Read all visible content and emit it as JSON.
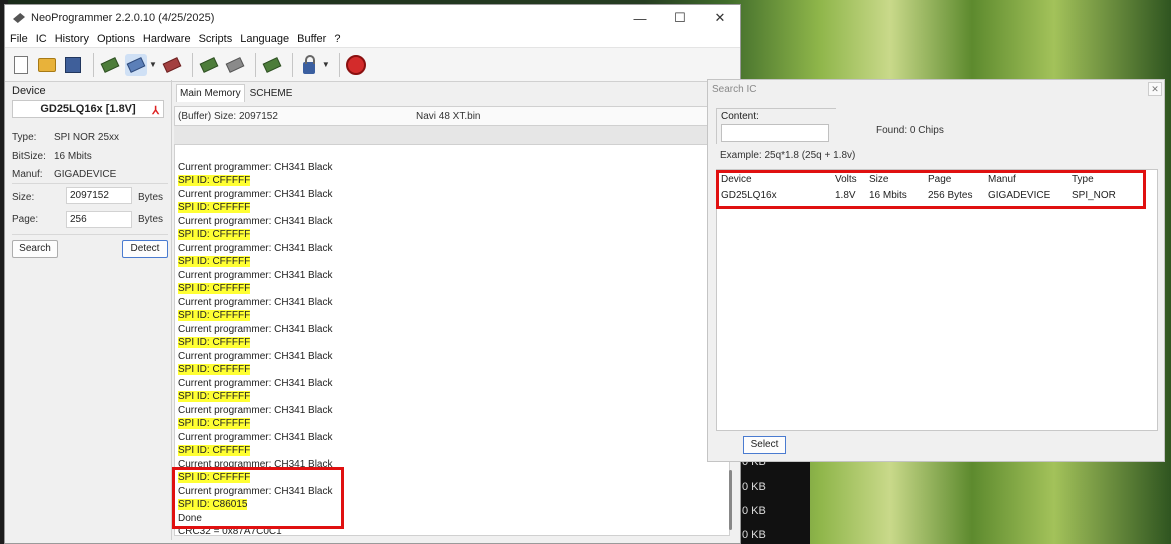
{
  "window": {
    "title": "NeoProgrammer 2.2.0.10 (4/25/2025)",
    "minimize": "—",
    "maximize": "☐",
    "close": "✕"
  },
  "menu": [
    "File",
    "IC",
    "History",
    "Options",
    "Hardware",
    "Scripts",
    "Language",
    "Buffer",
    "?"
  ],
  "device": {
    "section_label": "Device",
    "name": "GD25LQ16x [1.8V]",
    "type_key": "Type:",
    "type_val": "SPI NOR 25xx",
    "bitsize_key": "BitSize:",
    "bitsize_val": "16 Mbits",
    "manuf_key": "Manuf:",
    "manuf_val": "GIGADEVICE",
    "size_key": "Size:",
    "size_val": "2097152",
    "size_unit": "Bytes",
    "page_key": "Page:",
    "page_val": "256",
    "page_unit": "Bytes",
    "search_btn": "Search",
    "detect_btn": "Detect"
  },
  "tabs": [
    "Main Memory",
    "SCHEME"
  ],
  "buffer": {
    "size_text": "(Buffer) Size: 2097152",
    "file_name": "Navi 48 XT.bin"
  },
  "log": [
    {
      "text": "Current programmer: CH341 Black",
      "hl": false
    },
    {
      "text": "SPI ID: CFFFFF",
      "hl": true
    },
    {
      "text": "Current programmer: CH341 Black",
      "hl": false
    },
    {
      "text": "SPI ID: CFFFFF",
      "hl": true
    },
    {
      "text": "Current programmer: CH341 Black",
      "hl": false
    },
    {
      "text": "SPI ID: CFFFFF",
      "hl": true
    },
    {
      "text": "Current programmer: CH341 Black",
      "hl": false
    },
    {
      "text": "SPI ID: CFFFFF",
      "hl": true
    },
    {
      "text": "Current programmer: CH341 Black",
      "hl": false
    },
    {
      "text": "SPI ID: CFFFFF",
      "hl": true
    },
    {
      "text": "Current programmer: CH341 Black",
      "hl": false
    },
    {
      "text": "SPI ID: CFFFFF",
      "hl": true
    },
    {
      "text": "Current programmer: CH341 Black",
      "hl": false
    },
    {
      "text": "SPI ID: CFFFFF",
      "hl": true
    },
    {
      "text": "Current programmer: CH341 Black",
      "hl": false
    },
    {
      "text": "SPI ID: CFFFFF",
      "hl": true
    },
    {
      "text": "Current programmer: CH341 Black",
      "hl": false
    },
    {
      "text": "SPI ID: CFFFFF",
      "hl": true
    },
    {
      "text": "Current programmer: CH341 Black",
      "hl": false
    },
    {
      "text": "SPI ID: CFFFFF",
      "hl": true
    },
    {
      "text": "Current programmer: CH341 Black",
      "hl": false
    },
    {
      "text": "SPI ID: CFFFFF",
      "hl": true
    },
    {
      "text": "Current programmer: CH341 Black",
      "hl": false
    },
    {
      "text": "SPI ID: CFFFFF",
      "hl": true
    },
    {
      "text": "Current programmer: CH341 Black",
      "hl": false
    },
    {
      "text": "SPI ID: C86015",
      "hl": true
    },
    {
      "text": "Done",
      "hl": false
    },
    {
      "text": "CRC32 = 0x87A7C0C1",
      "hl": false
    }
  ],
  "search_dialog": {
    "title": "Search IC",
    "content_label": "Content:",
    "content_value": "",
    "found": "Found: 0 Chips",
    "example": "Example:  25q*1.8 (25q + 1.8v)",
    "columns": [
      "Device",
      "Volts",
      "Size",
      "Page",
      "Manuf",
      "Type"
    ],
    "rows": [
      [
        "GD25LQ16x",
        "1.8V",
        "16 Mbits",
        "256 Bytes",
        "GIGADEVICE",
        "SPI_NOR"
      ]
    ],
    "select_btn": "Select"
  },
  "background_sizes": [
    "0 KB",
    "0 KB",
    "0 KB",
    "0 KB"
  ],
  "colors": {
    "highlight": "#ffff33",
    "annotation_box": "#e01010",
    "select_border": "#4a7bd0"
  }
}
